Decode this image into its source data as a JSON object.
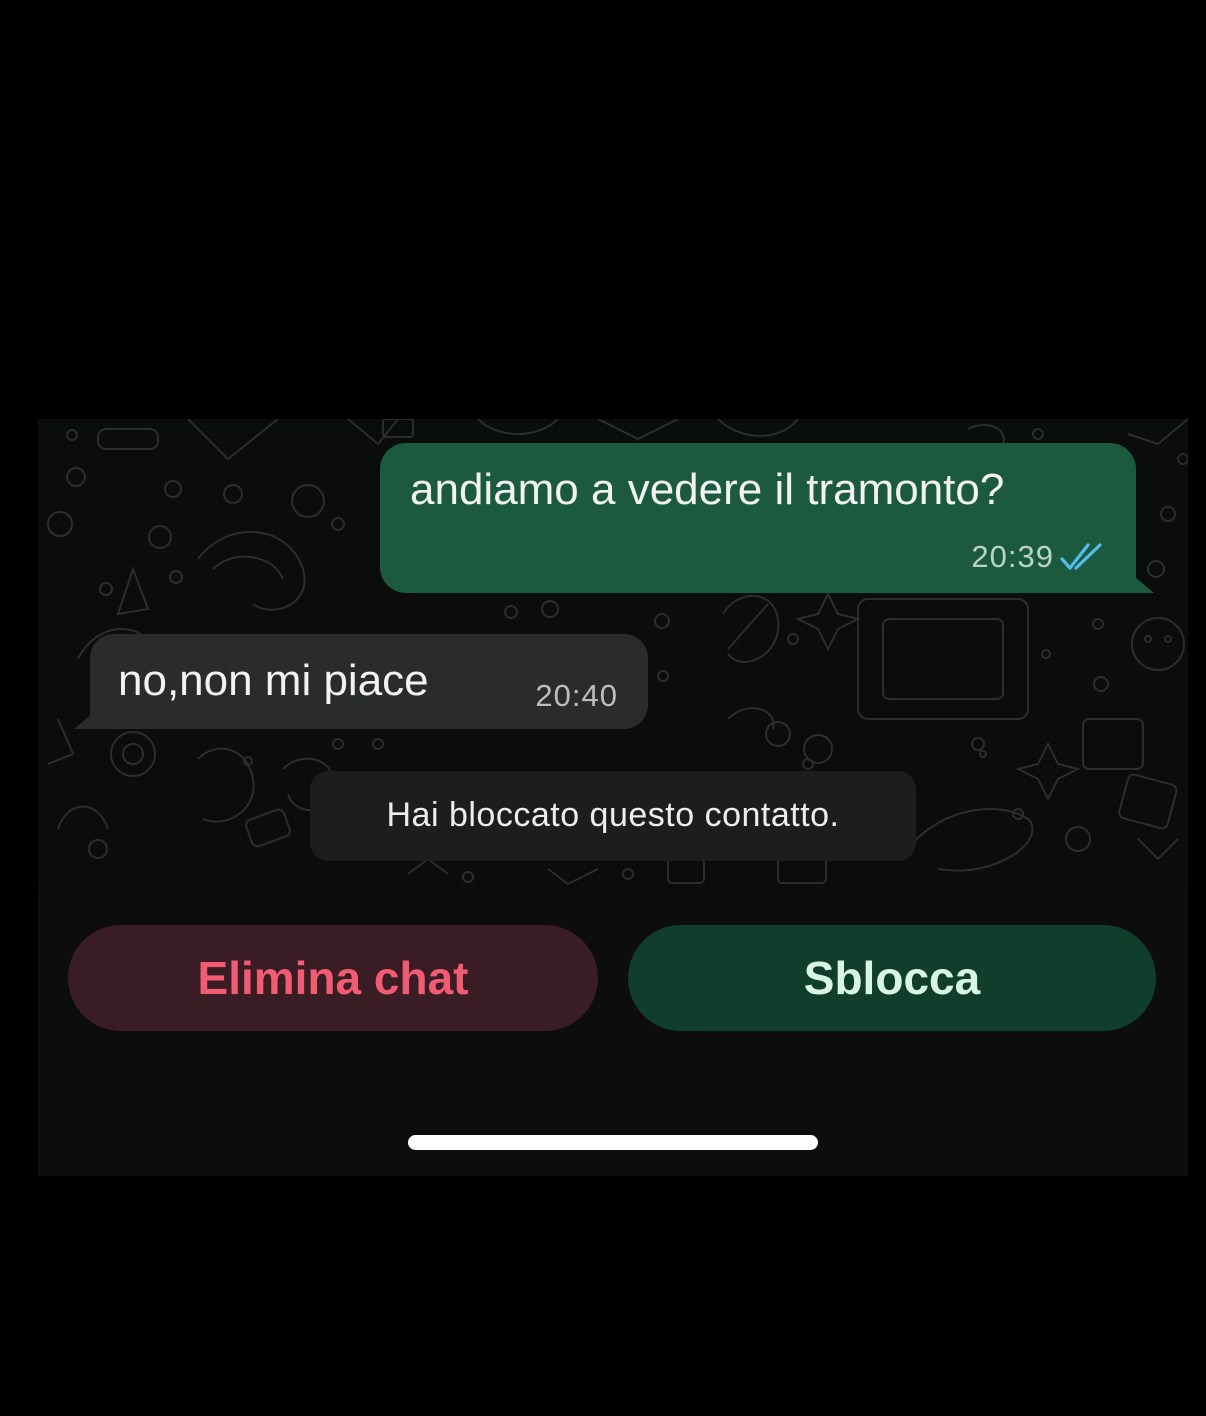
{
  "chat": {
    "messages": [
      {
        "direction": "outgoing",
        "text": "andiamo a vedere il tramonto?",
        "time": "20:39",
        "status_icon": "double-check-read-icon"
      },
      {
        "direction": "incoming",
        "text": "no,non mi piace",
        "time": "20:40"
      }
    ],
    "system_notice": "Hai bloccato questo contatto."
  },
  "actions": {
    "delete_label": "Elimina chat",
    "unblock_label": "Sblocca"
  },
  "colors": {
    "outgoing_bubble": "#1b5a3f",
    "incoming_bubble": "#2a2c2b",
    "delete_text": "#f15c73",
    "delete_bg": "#3a1c24",
    "unblock_bg": "#113d2c",
    "read_ticks": "#53bdeb"
  }
}
